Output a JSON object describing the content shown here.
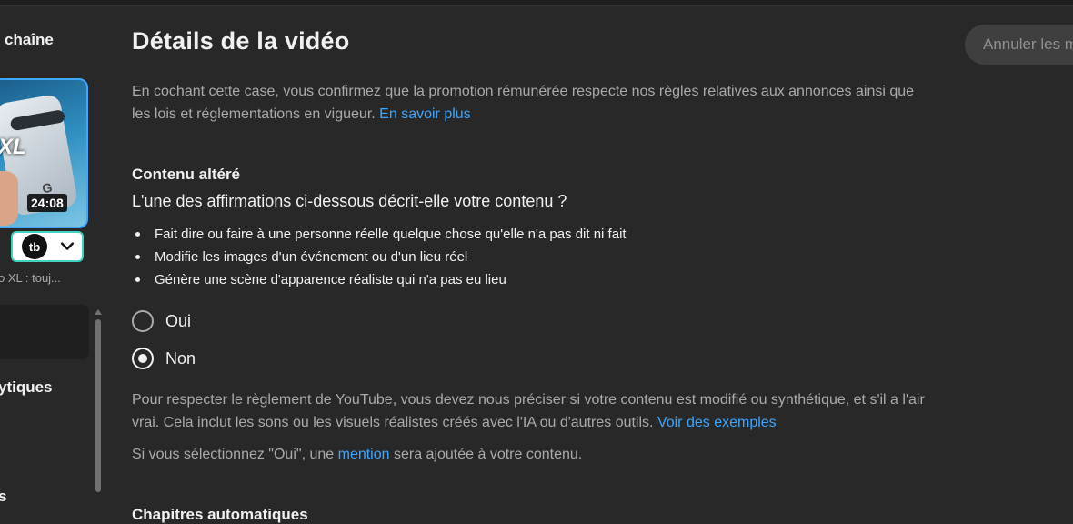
{
  "sidebar": {
    "title": "chaîne",
    "thumbnail_text": "XL",
    "thumbnail_duration": "24:08",
    "video_title": "o XL : touj...",
    "items": [
      {
        "label": "ytiques"
      },
      {
        "label": "s"
      }
    ]
  },
  "header": {
    "title": "Détails de la vidéo",
    "undo_label": "Annuler les m"
  },
  "promo": {
    "text": "En cochant cette case, vous confirmez que la promotion rémunérée respecte nos règles relatives aux annonces ainsi que les lois et réglementations en vigueur.",
    "link": "En savoir plus"
  },
  "altered": {
    "heading": "Contenu altéré",
    "question": "L'une des affirmations ci-dessous décrit-elle votre contenu ?",
    "bullets": [
      "Fait dire ou faire à une personne réelle quelque chose qu'elle n'a pas dit ni fait",
      "Modifie les images d'un événement ou d'un lieu réel",
      "Génère une scène d'apparence réaliste qui n'a pas eu lieu"
    ],
    "options": [
      {
        "label": "Oui",
        "selected": false
      },
      {
        "label": "Non",
        "selected": true
      }
    ],
    "policy_text": "Pour respecter le règlement de YouTube, vous devez nous préciser si votre contenu est modifié ou synthétique, et s'il a l'air vrai. Cela inclut les sons ou les visuels réalistes créés avec l'IA ou d'autres outils.",
    "policy_link": "Voir des exemples",
    "mention_prefix": "Si vous sélectionnez \"Oui\", une",
    "mention_link": "mention",
    "mention_suffix": "sera ajoutée à votre contenu."
  },
  "chapters": {
    "heading": "Chapitres automatiques"
  },
  "icons": {
    "thumbnail_logo": "google-g-logo",
    "extension": "tubebuddy-logo",
    "dropdown": "chevron-down-icon"
  }
}
